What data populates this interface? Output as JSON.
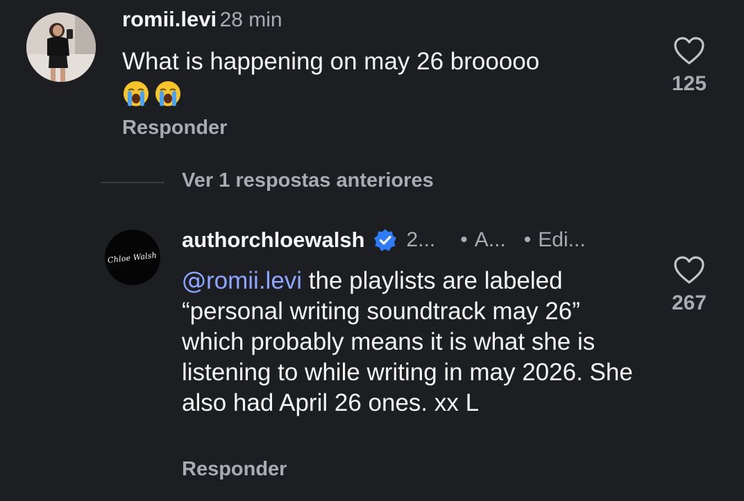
{
  "comment": {
    "username": "romii.levi",
    "time": "28 min",
    "text": "What is happening on may 26 brooooo",
    "emojis": [
      "loudly-crying-face",
      "loudly-crying-face"
    ],
    "like_count": "125",
    "reply_label": "Responder"
  },
  "view_replies_label": "Ver 1 respostas anteriores",
  "reply": {
    "username": "authorchloewalsh",
    "verified": true,
    "meta_time": "2...",
    "meta_author": "A...",
    "meta_edited": "Edi...",
    "avatar_text": "Chloe Walsh",
    "mention": "romii.levi",
    "text": " the playlists are labeled “personal writing soundtrack may 26” which probably means it is what she is listening to while writing in may 2026. She also had April 26 ones. xx L",
    "like_count": "267",
    "reply_label": "Responder"
  },
  "colors": {
    "background": "#1c1e22",
    "mention": "#8da6ff",
    "verified": "#2f7bf6",
    "secondary_text": "#a8abb0"
  }
}
